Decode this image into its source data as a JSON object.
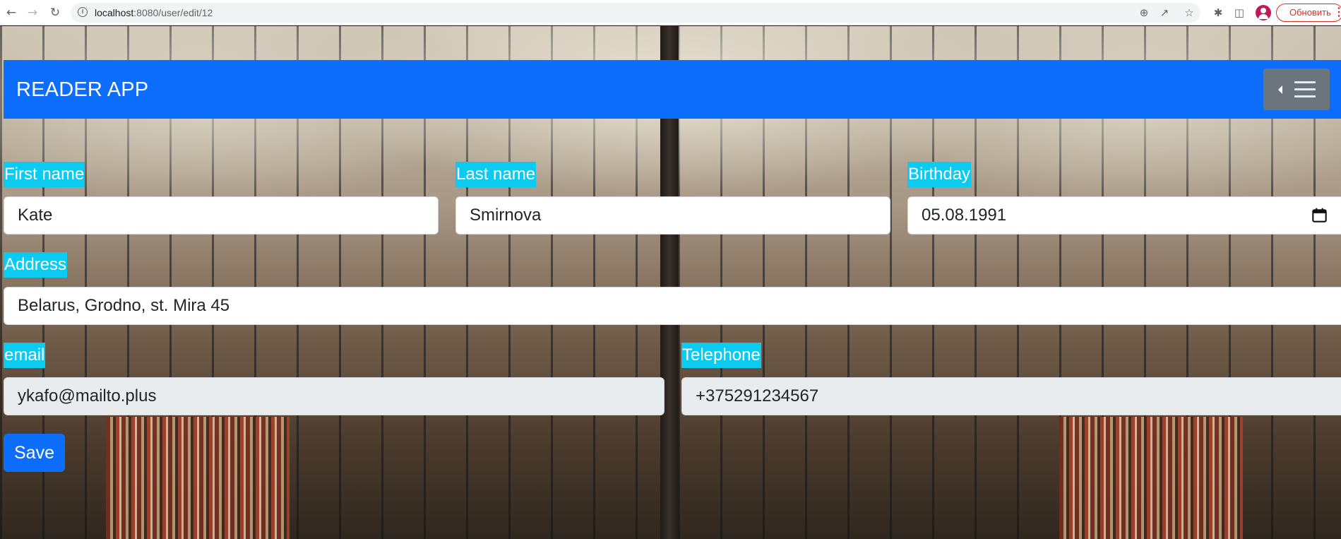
{
  "browser": {
    "url_host": "localhost",
    "url_rest": ":8080/user/edit/12",
    "update_label": "Обновить",
    "icons": [
      "back-icon",
      "forward-icon",
      "reload-icon",
      "info-icon",
      "zoom-icon",
      "share-icon",
      "star-icon",
      "extensions-icon",
      "sidebar-icon",
      "profile-icon",
      "menu-icon"
    ]
  },
  "navbar": {
    "brand": "READER APP",
    "toggler_icons": [
      "caret-left-icon",
      "hamburger-icon"
    ]
  },
  "form": {
    "first_name": {
      "label": "First name",
      "value": "Kate"
    },
    "last_name": {
      "label": "Last name",
      "value": "Smirnova"
    },
    "birthday": {
      "label": "Birthday",
      "value": "05.08.1991"
    },
    "address": {
      "label": "Address",
      "value": "Belarus, Grodno, st. Mira 45"
    },
    "email": {
      "label": "email",
      "value": "ykafo@mailto.plus"
    },
    "telephone": {
      "label": "Telephone",
      "value": "+375291234567"
    },
    "save_label": "Save"
  },
  "colors": {
    "navbar": "#0d6efd",
    "label_bg": "#0dcaf0",
    "toggler": "#6c757d",
    "readonly_input": "#e9ecef",
    "update_btn": "#d93025"
  }
}
